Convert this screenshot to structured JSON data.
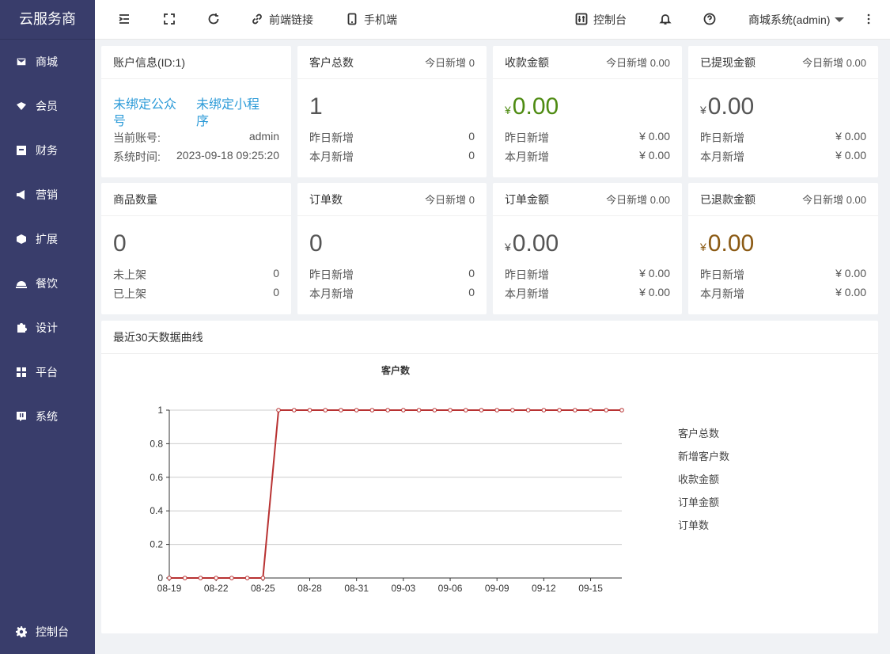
{
  "sidebar": {
    "brand": "云服务商",
    "items": [
      {
        "label": "商城",
        "icon": "mall-icon"
      },
      {
        "label": "会员",
        "icon": "member-icon"
      },
      {
        "label": "财务",
        "icon": "finance-icon"
      },
      {
        "label": "营销",
        "icon": "megaphone-icon"
      },
      {
        "label": "扩展",
        "icon": "cube-icon"
      },
      {
        "label": "餐饮",
        "icon": "dining-icon"
      },
      {
        "label": "设计",
        "icon": "puzzle-icon"
      },
      {
        "label": "平台",
        "icon": "grid-icon"
      },
      {
        "label": "系统",
        "icon": "system-icon"
      }
    ],
    "bottom": {
      "label": "控制台",
      "icon": "gear-icon"
    }
  },
  "header": {
    "frontend_link": "前端链接",
    "mobile": "手机端",
    "console": "控制台",
    "user": "商城系统(admin)"
  },
  "cards": {
    "account": {
      "title": "账户信息(ID:1)",
      "link1": "未绑定公众号",
      "link2": "未绑定小程序",
      "account_label": "当前账号:",
      "account_value": "admin",
      "time_label": "系统时间:",
      "time_value": "2023-09-18 09:25:20"
    },
    "customers": {
      "title": "客户总数",
      "today": "今日新增 0",
      "value": "1",
      "r1_label": "昨日新增",
      "r1_value": "0",
      "r2_label": "本月新增",
      "r2_value": "0"
    },
    "revenue": {
      "title": "收款金额",
      "today": "今日新增 0.00",
      "yen": "¥",
      "value": "0.00",
      "r1_label": "昨日新增",
      "r1_value": "¥ 0.00",
      "r2_label": "本月新增",
      "r2_value": "¥ 0.00"
    },
    "withdrawn": {
      "title": "已提现金额",
      "today": "今日新增 0.00",
      "yen": "¥",
      "value": "0.00",
      "r1_label": "昨日新增",
      "r1_value": "¥ 0.00",
      "r2_label": "本月新增",
      "r2_value": "¥ 0.00"
    },
    "products": {
      "title": "商品数量",
      "value": "0",
      "r1_label": "未上架",
      "r1_value": "0",
      "r2_label": "已上架",
      "r2_value": "0"
    },
    "orders": {
      "title": "订单数",
      "today": "今日新增 0",
      "value": "0",
      "r1_label": "昨日新增",
      "r1_value": "0",
      "r2_label": "本月新增",
      "r2_value": "0"
    },
    "order_amount": {
      "title": "订单金额",
      "today": "今日新增 0.00",
      "yen": "¥",
      "value": "0.00",
      "r1_label": "昨日新增",
      "r1_value": "¥ 0.00",
      "r2_label": "本月新增",
      "r2_value": "¥ 0.00"
    },
    "refunded": {
      "title": "已退款金额",
      "today": "今日新增 0.00",
      "yen": "¥",
      "value": "0.00",
      "r1_label": "昨日新增",
      "r1_value": "¥ 0.00",
      "r2_label": "本月新增",
      "r2_value": "¥ 0.00"
    }
  },
  "chart_panel": {
    "title": "最近30天数据曲线"
  },
  "chart_data": {
    "type": "line",
    "title": "客户数",
    "ylim": [
      0,
      1
    ],
    "yticks": [
      "0",
      "0.2",
      "0.4",
      "0.6",
      "0.8",
      "1"
    ],
    "x": [
      "08-19",
      "08-20",
      "08-21",
      "08-22",
      "08-23",
      "08-24",
      "08-25",
      "08-26",
      "08-27",
      "08-28",
      "08-29",
      "08-30",
      "08-31",
      "09-01",
      "09-02",
      "09-03",
      "09-04",
      "09-05",
      "09-06",
      "09-07",
      "09-08",
      "09-09",
      "09-10",
      "09-11",
      "09-12",
      "09-13",
      "09-14",
      "09-15",
      "09-16",
      "09-17"
    ],
    "xtick_labels": [
      "08-19",
      "08-22",
      "08-25",
      "08-28",
      "08-31",
      "09-03",
      "09-06",
      "09-09",
      "09-12",
      "09-15"
    ],
    "series": [
      {
        "values": [
          0,
          0,
          0,
          0,
          0,
          0,
          0,
          1,
          1,
          1,
          1,
          1,
          1,
          1,
          1,
          1,
          1,
          1,
          1,
          1,
          1,
          1,
          1,
          1,
          1,
          1,
          1,
          1,
          1,
          1
        ]
      }
    ],
    "legend": [
      "客户总数",
      "新增客户数",
      "收款金额",
      "订单金额",
      "订单数"
    ],
    "line_color": "#b83232",
    "grid": true
  }
}
